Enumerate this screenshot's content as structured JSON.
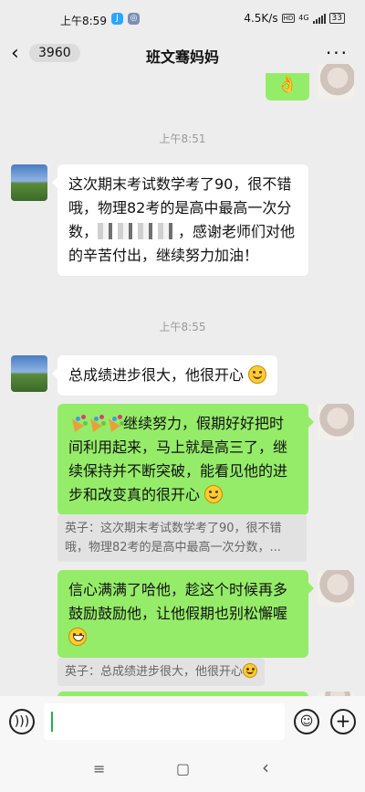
{
  "status_bar": {
    "time": "上午8:59",
    "net_speed": "4.5K/s",
    "hd": "HD",
    "network": "4G",
    "battery": "33"
  },
  "header": {
    "back_icon": "chevron-left-icon",
    "unread_count": "3960",
    "title": "班文骞妈妈",
    "more_icon": "more-dots-icon"
  },
  "messages": {
    "sent_top_emoji": "👌",
    "time1": "上午8:51",
    "m1_text_a": "这次期末考试数学考了90，很不错哦，物理82考的是高中最高一次分数，",
    "m1_text_b": "，感谢老师们对他的辛苦付出，继续努力加油！",
    "time2": "上午8:55",
    "m2_text": "总成绩进步很大，他很开心",
    "m3_text": "继续努力，假期好好把时间利用起来，马上就是高三了，继续保持并不断突破，能看见他的进步和改变真的很开心",
    "q1_text": "英子：这次期末考试数学考了90，很不错哦，物理82考的是高中最高一次分数，...",
    "m4_text": "信心满满了哈他，趁这个时候再多鼓励鼓励他，让他假期也别松懈喔",
    "q2_text": "英子：总成绩进步很大，他很开心"
  },
  "input": {
    "voice_icon": "voice-icon",
    "emoji_icon": "emoji-icon",
    "plus_icon": "plus-icon"
  },
  "nav": {
    "menu": "≡",
    "home": "▢",
    "back": "‹"
  }
}
